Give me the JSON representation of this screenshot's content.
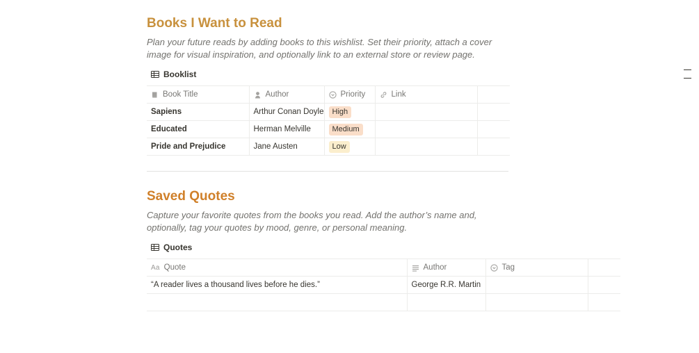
{
  "books": {
    "heading": "Books I Want to Read",
    "heading_color": "#c8913d",
    "description": "Plan your future reads by adding books to this wishlist. Set their priority, attach a cover image for visual inspiration, and optionally link to an external store or review page.",
    "database_title": "Booklist",
    "database_icon": "table-icon",
    "columns": [
      {
        "label": "Book Title",
        "icon": "book-icon"
      },
      {
        "label": "Author",
        "icon": "person-icon"
      },
      {
        "label": "Priority",
        "icon": "select-icon"
      },
      {
        "label": "Link",
        "icon": "link-icon"
      }
    ],
    "rows": [
      {
        "title": "Sapiens",
        "author": "Arthur Conan Doyle",
        "priority": "High",
        "priority_color": "#fadec9"
      },
      {
        "title": "Educated",
        "author": "Herman Melville",
        "priority": "Medium",
        "priority_color": "#fadec9"
      },
      {
        "title": "Pride and Prejudice",
        "author": "Jane Austen",
        "priority": "Low",
        "priority_color": "#fbeecd"
      }
    ]
  },
  "quotes": {
    "heading": "Saved Quotes",
    "heading_color": "#d0802a",
    "description": "Capture your favorite quotes from the books you read. Add the author’s name and, optionally, tag your quotes by mood, genre, or personal meaning.",
    "database_title": "Quotes",
    "database_icon": "table-icon",
    "columns": [
      {
        "label": "Quote",
        "icon": "text-aa-icon",
        "icon_text": "Aa"
      },
      {
        "label": "Author",
        "icon": "lines-icon"
      },
      {
        "label": "Tag",
        "icon": "select-icon"
      }
    ],
    "rows": [
      {
        "quote": "“A reader lives a thousand lives before he dies.”",
        "author": "George R.R. Martin",
        "tag": ""
      },
      {
        "quote": "",
        "author": "",
        "tag": ""
      }
    ]
  }
}
